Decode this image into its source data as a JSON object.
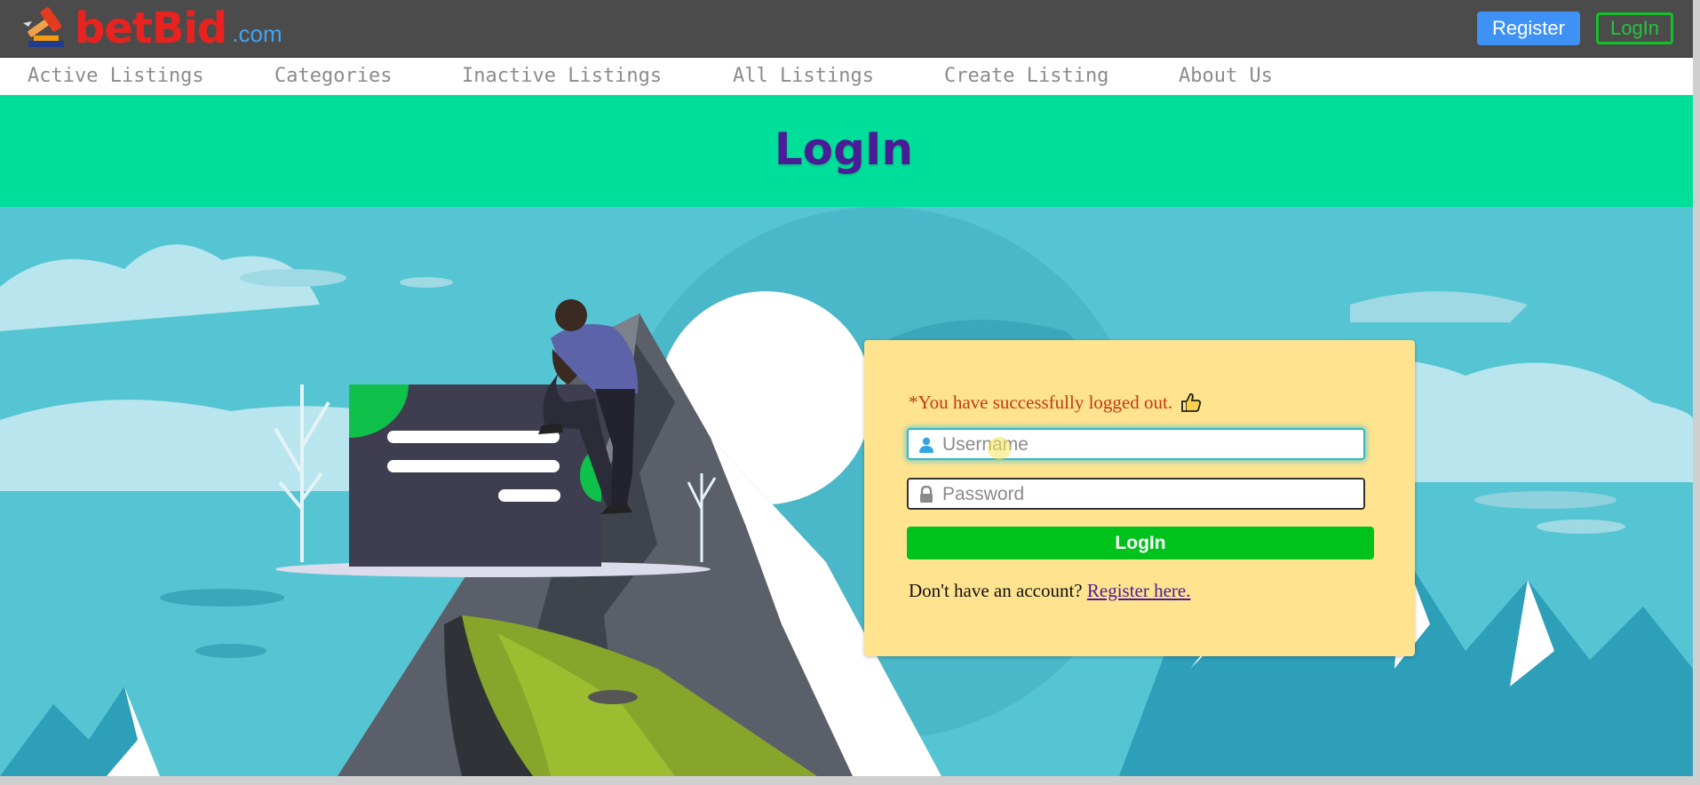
{
  "brand": {
    "name": "betBid",
    "suffix": ".com",
    "logo_icon": "gavel-icon"
  },
  "header": {
    "register_label": "Register",
    "login_label": "LogIn"
  },
  "nav": {
    "items": [
      {
        "label": "Active Listings"
      },
      {
        "label": "Categories"
      },
      {
        "label": "Inactive Listings"
      },
      {
        "label": "All Listings"
      },
      {
        "label": "Create Listing"
      },
      {
        "label": "About Us"
      }
    ]
  },
  "hero": {
    "title": "LogIn"
  },
  "login_form": {
    "message": "*You have successfully logged out.",
    "message_icon": "thumbs-up-icon",
    "username_placeholder": "Username",
    "username_icon": "user-icon",
    "password_placeholder": "Password",
    "password_icon": "lock-icon",
    "submit_label": "LogIn",
    "register_prompt": "Don't have an account?",
    "register_link": "Register here."
  },
  "colors": {
    "header_bg": "#4b4b4b",
    "brand_red": "#e8231f",
    "brand_blue": "#3fa3f5",
    "hero_band": "#00df9a",
    "hero_title": "#4a1d96",
    "card_bg": "#ffe38e",
    "login_button": "#00c21d",
    "error_text": "#c23a10"
  }
}
